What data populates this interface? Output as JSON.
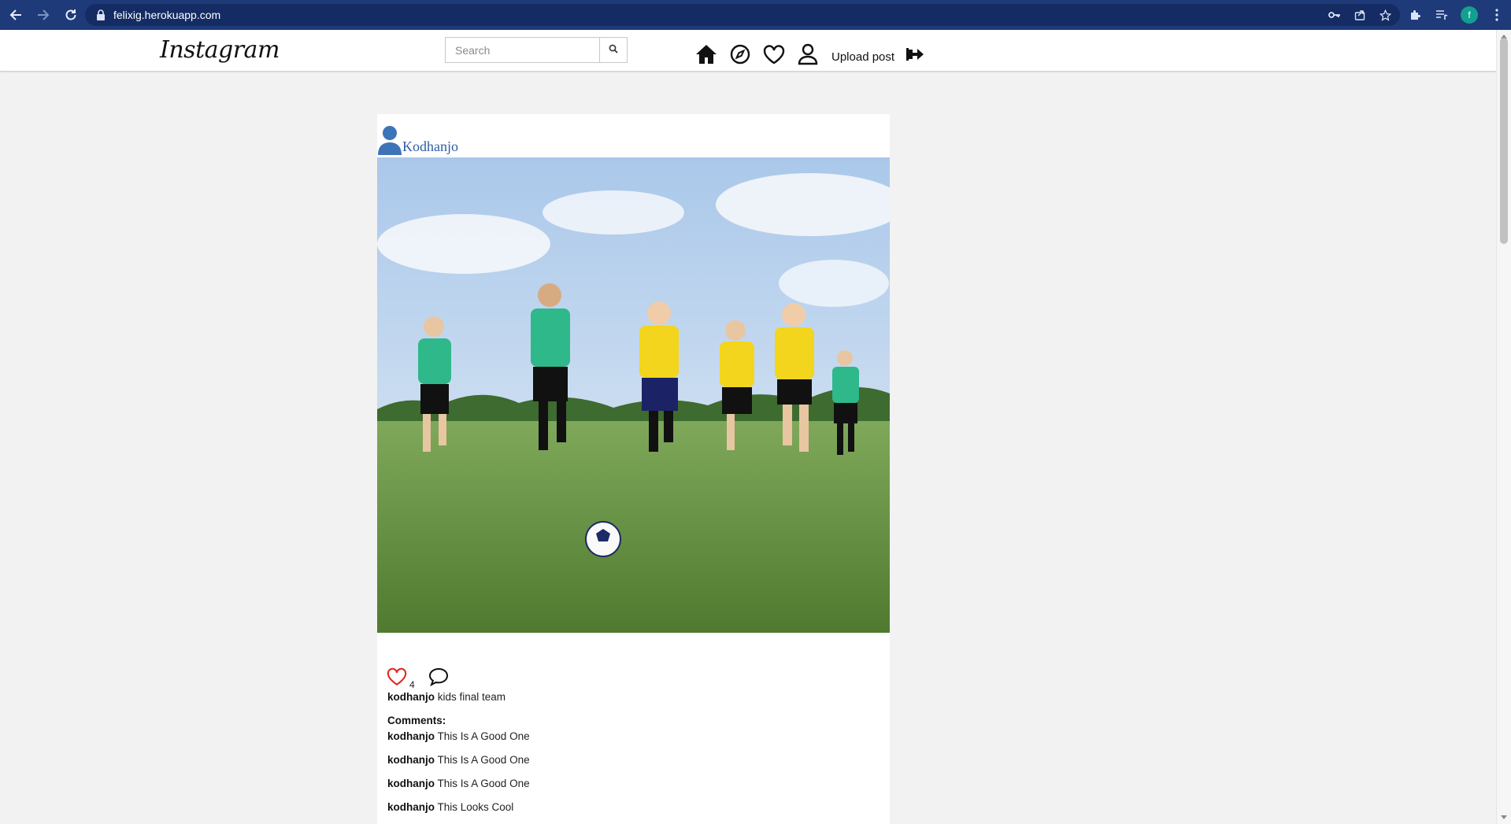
{
  "browser": {
    "url": "felixig.herokuapp.com",
    "profile_initial": "f"
  },
  "app": {
    "logo": "Instagram",
    "search": {
      "placeholder": "Search",
      "value": ""
    },
    "nav": {
      "upload_label": "Upload post"
    }
  },
  "post": {
    "author": "Kodhanjo",
    "image_alt": "kids playing soccer",
    "like_count": "4",
    "caption": {
      "user": "kodhanjo",
      "text": "kids final team"
    },
    "comments_label": "Comments:",
    "comments": [
      {
        "user": "kodhanjo",
        "text": "This Is A Good One"
      },
      {
        "user": "kodhanjo",
        "text": "This Is A Good One"
      },
      {
        "user": "kodhanjo",
        "text": "This Is A Good One"
      },
      {
        "user": "kodhanjo",
        "text": "This Looks Cool"
      }
    ]
  },
  "colors": {
    "chrome_bg": "#1e3a78",
    "link_blue": "#2d5ea7",
    "like_red": "#e0241f",
    "page_bg": "#f2f2f2"
  }
}
